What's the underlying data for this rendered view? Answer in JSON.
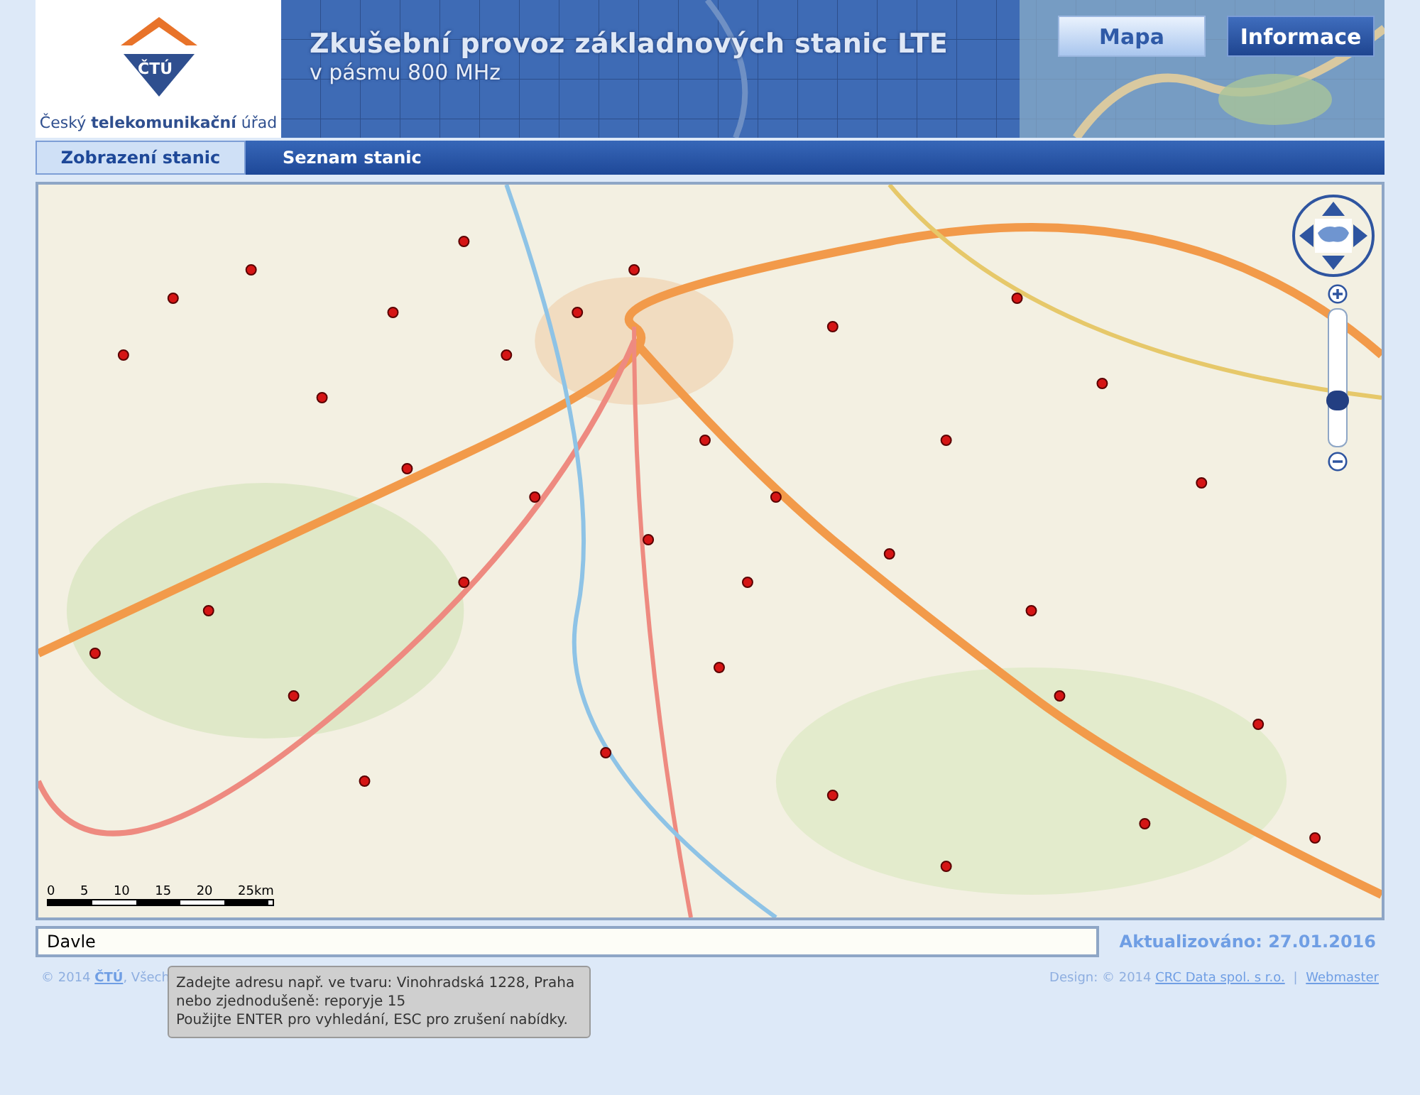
{
  "logo": {
    "mark": "ČTÚ",
    "name": "Český **telekomunikační** úřad"
  },
  "header": {
    "title": "Zkušební provoz základnových stanic LTE",
    "subtitle": "v pásmu 800 MHz"
  },
  "top_buttons": [
    {
      "label": "Mapa",
      "selected": false
    },
    {
      "label": "Informace",
      "selected": true
    }
  ],
  "tabs": [
    {
      "label": "Zobrazení stanic",
      "selected": true
    },
    {
      "label": "Seznam stanic",
      "selected": false
    }
  ],
  "map": {
    "kind": "picture",
    "zoom": {
      "level": 0.3
    },
    "scale_labels": [
      "0",
      "5",
      "10",
      "15",
      "20",
      "25km"
    ]
  },
  "search": {
    "value": "Davle"
  },
  "updated": "Aktualizováno: 27.01.2016",
  "footer": {
    "copyright": "© 2014 ",
    "owner_link": "ČTÚ",
    "rest": ", Všech",
    "design": "Design: © 2014 ",
    "design_link": "CRC Data spol. s r.o.",
    "separator": "|",
    "webmaster": "Webmaster"
  },
  "tooltip": [
    "Zadejte adresu např. ve tvaru: Vinohradská 1228, Praha",
    "nebo zjednodušeně: reporyje 15",
    "Použijte ENTER pro vyhledání, ESC pro zrušení nabídky."
  ]
}
